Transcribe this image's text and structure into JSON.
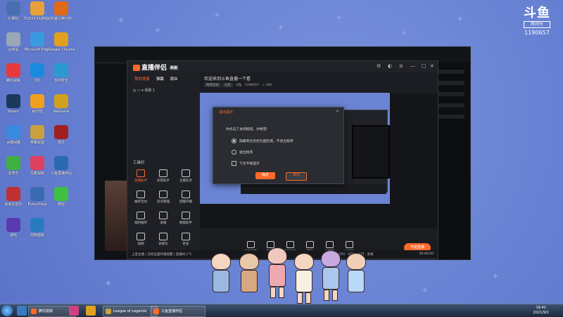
{
  "room_badge": {
    "logo": "斗鱼",
    "tag": "房间号",
    "number": "1190657"
  },
  "desktop_icons": [
    {
      "label": "计算机",
      "color": "#4a6fb0"
    },
    {
      "label": "TGXXXXX游戏助手",
      "color": "#e8a13a"
    },
    {
      "label": "红警三倒计时",
      "color": "#e06a1a"
    },
    {
      "label": "回收站",
      "color": "#9aa7b8"
    },
    {
      "label": "Microsoft Edge",
      "color": "#3a9ae0"
    },
    {
      "label": "Google Chrome",
      "color": "#e0a020"
    },
    {
      "label": "腾讯视频",
      "color": "#e83a3a"
    },
    {
      "label": "QQ",
      "color": "#1a8ae0"
    },
    {
      "label": "360安全",
      "color": "#2a9ad0"
    },
    {
      "label": "Steam",
      "color": "#1a3a5a"
    },
    {
      "label": "租号玩",
      "color": "#f0a020"
    },
    {
      "label": "WeGame",
      "color": "#d0a020"
    },
    {
      "label": "百度网盘",
      "color": "#3a8ae0"
    },
    {
      "label": "英雄联盟",
      "color": "#c8a040"
    },
    {
      "label": "剑灵",
      "color": "#a02020"
    },
    {
      "label": "爱奇艺",
      "color": "#40b040"
    },
    {
      "label": "优酷视频",
      "color": "#e04060"
    },
    {
      "label": "斗鱼直播伴侣",
      "color": "#2a6ab0"
    },
    {
      "label": "网易云音乐",
      "color": "#c03030"
    },
    {
      "label": "Everything",
      "color": "#3a6ab0"
    },
    {
      "label": "微信",
      "color": "#40c040"
    },
    {
      "label": "游戏",
      "color": "#5a3ab0"
    },
    {
      "label": "控制面板",
      "color": "#2a7ac0"
    }
  ],
  "live": {
    "logo": "直播伴侣",
    "tag": "新版",
    "tabs": [
      "我的场景",
      "弹幕",
      "观众"
    ],
    "scene": "场景 1",
    "tools_title": "工具栏",
    "tools": [
      "直播助手",
      "房管助手",
      "主播任务",
      "抽奖活动",
      "房间管理",
      "提醒开播",
      "福利抽奖",
      "录播",
      "数据助手",
      "视频",
      "表情包",
      "更多"
    ],
    "room_title": "欢迎来到斗鱼直播一个看",
    "room_meta": [
      "网游竞技",
      "分区",
      "斗鱼",
      "1190657",
      "100"
    ],
    "bottom_items": [
      "直播设置",
      "摄像头",
      "手机投屏",
      "游戏",
      "麦克风",
      "扬声器"
    ],
    "start_button": "开始直播",
    "status_left": "上麦主播 | 已经设置开播提醒 | 直播间人气",
    "status_time": "00:00:00",
    "status_stats": [
      "CPU",
      "GPU",
      "上行",
      "丢帧"
    ]
  },
  "dialog": {
    "title": "退出提示",
    "close": "×",
    "question": "你点击了关闭按钮，你希望：",
    "option_minimize": "隐藏到任务栏托盘区域，不退出程序",
    "option_quit": "退出程序",
    "checkbox": "下次不再提示",
    "ok": "确定",
    "cancel": "取消"
  },
  "taskbar": {
    "items": [
      "腾讯视频",
      "League of Legends",
      "斗鱼直播伴侣"
    ],
    "clock_time": "16:42",
    "clock_date": "2021/9/1"
  }
}
